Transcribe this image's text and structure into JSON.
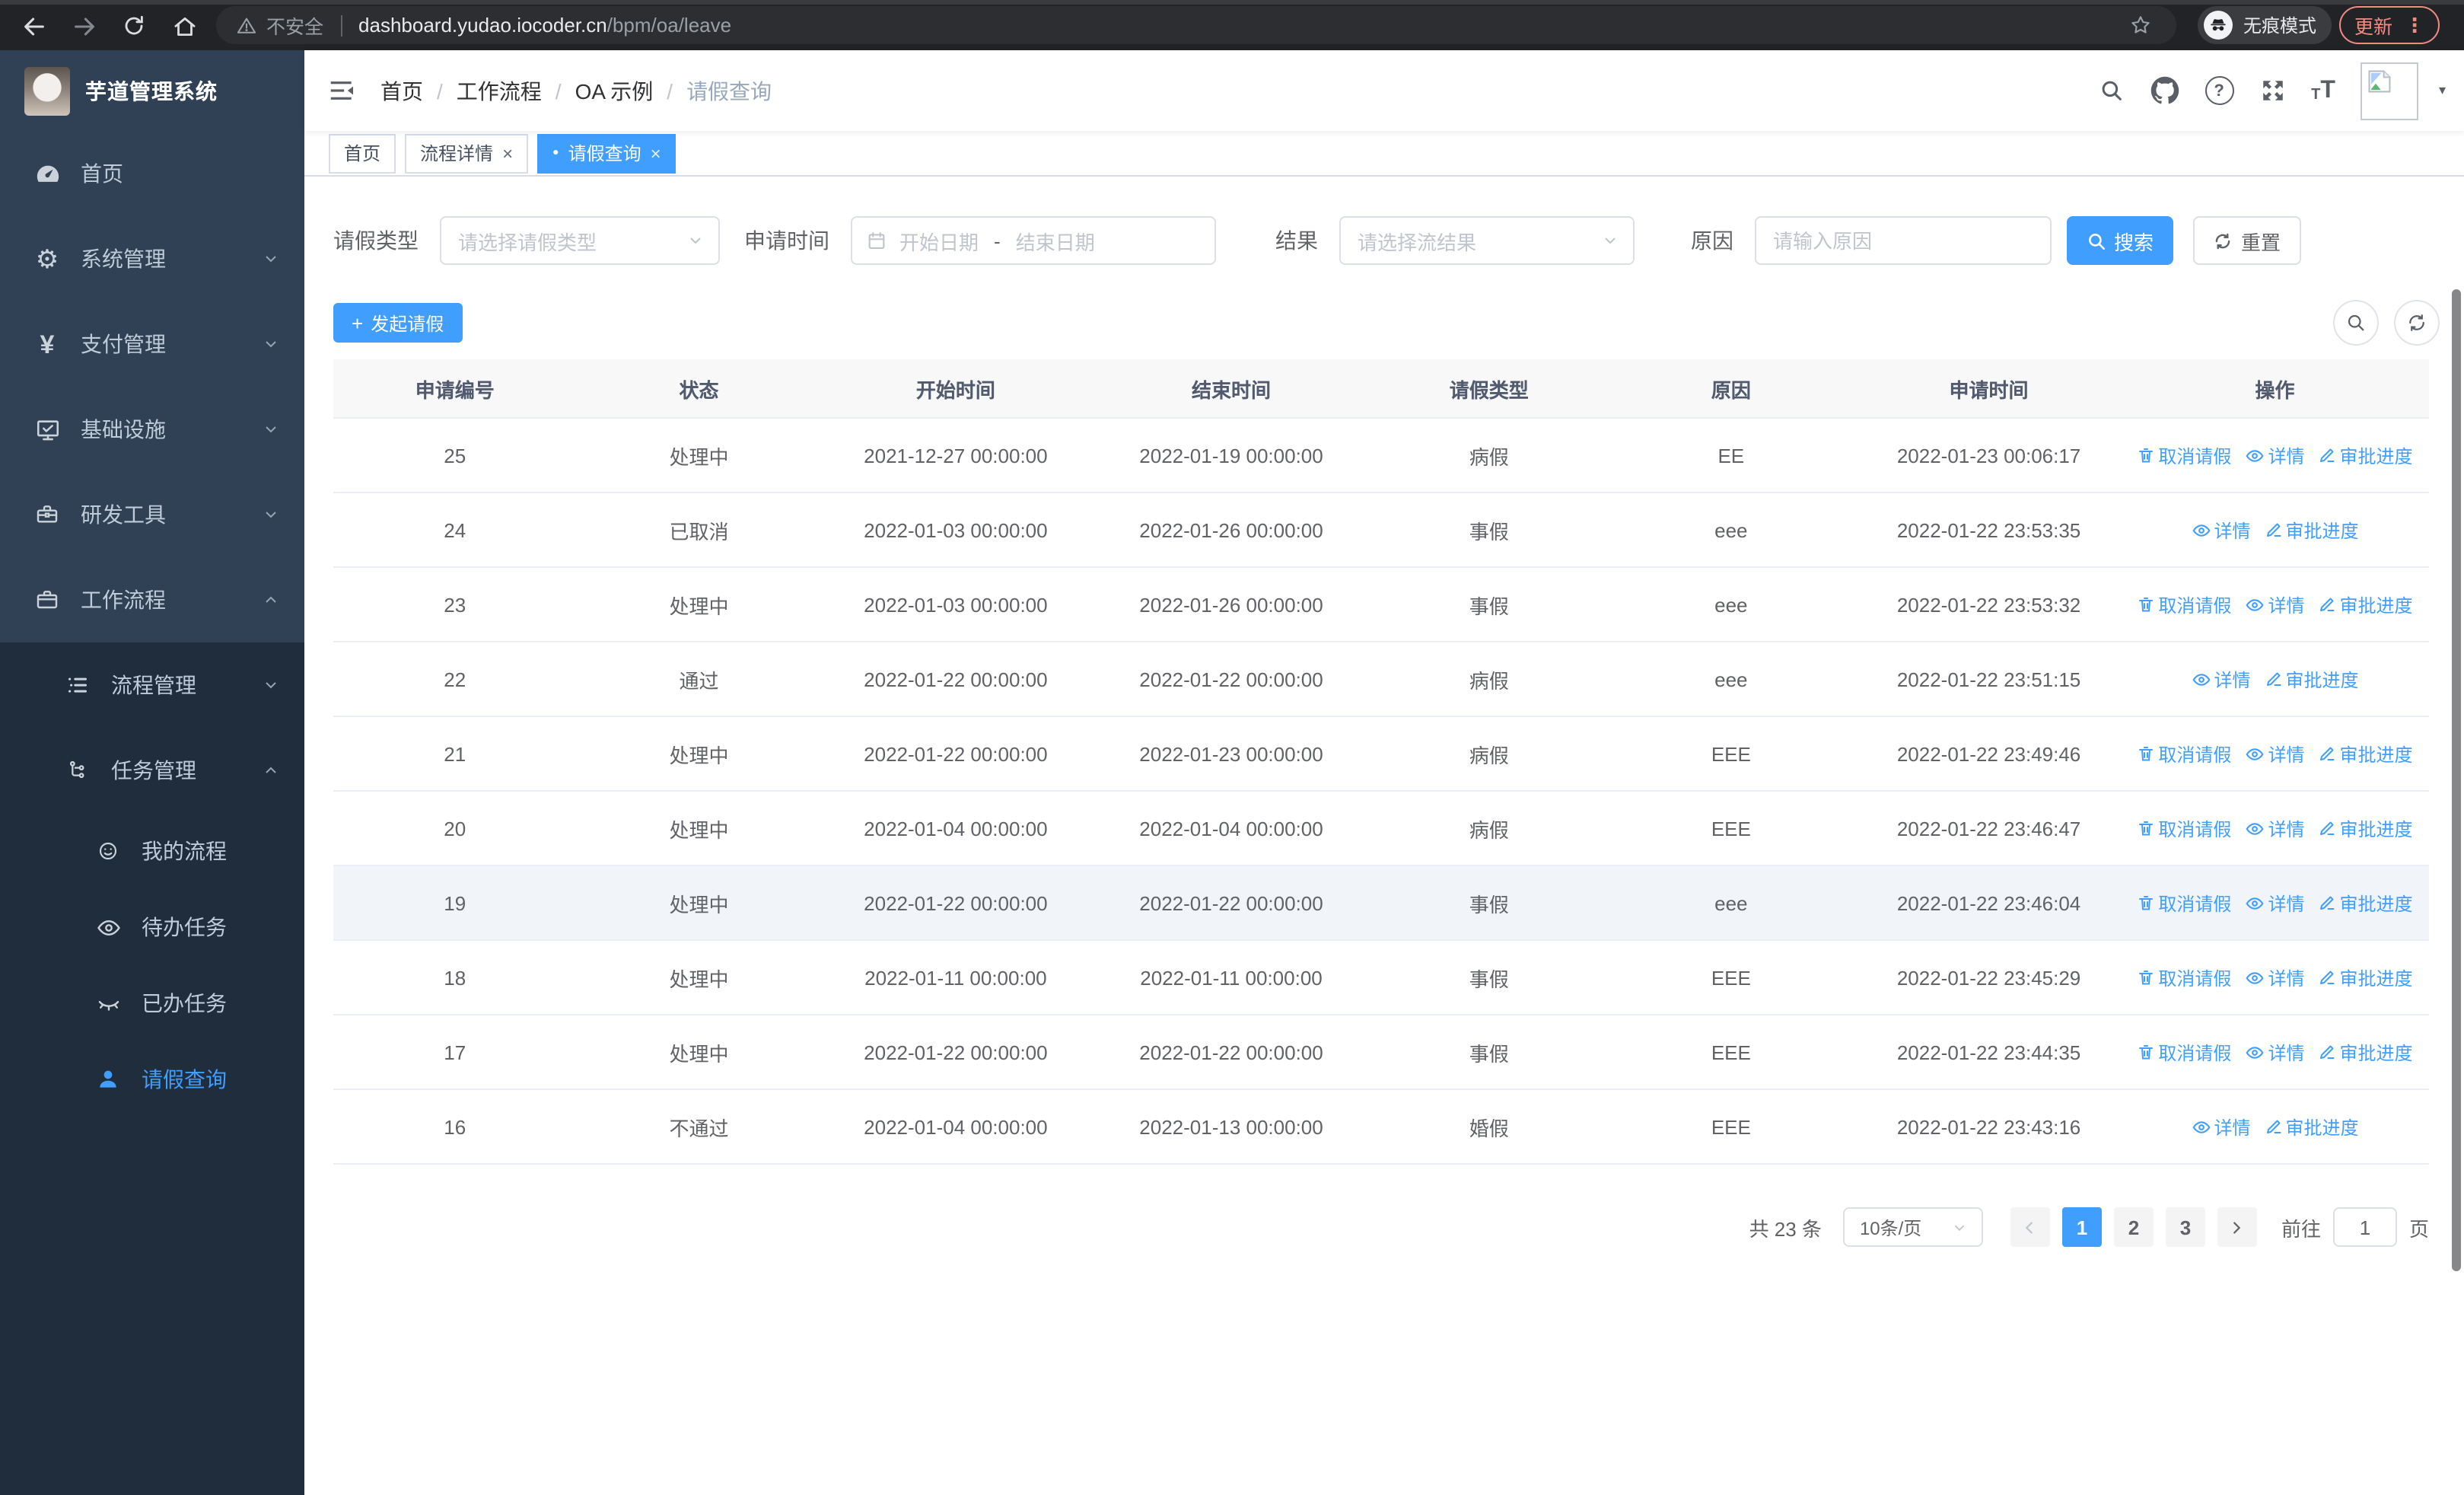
{
  "browser": {
    "security_label": "不安全",
    "url_host": "dashboard.yudao.iocoder.cn",
    "url_path": "/bpm/oa/leave",
    "incognito_label": "无痕模式",
    "update_label": "更新"
  },
  "icons": {
    "close": "×",
    "tab_dot": "●",
    "more_vertical": "⋮",
    "caret_down": "▾",
    "plus": "+",
    "yen": "¥",
    "gear": "⚙",
    "question": "?"
  },
  "sidebar": {
    "logo_title": "芋道管理系统",
    "menu": [
      {
        "label": "首页"
      },
      {
        "label": "系统管理"
      },
      {
        "label": "支付管理"
      },
      {
        "label": "基础设施"
      },
      {
        "label": "研发工具"
      },
      {
        "label": "工作流程"
      },
      {
        "label": "流程管理"
      },
      {
        "label": "任务管理"
      },
      {
        "label": "我的流程"
      },
      {
        "label": "待办任务"
      },
      {
        "label": "已办任务"
      },
      {
        "label": "请假查询"
      }
    ]
  },
  "header": {
    "breadcrumb": [
      "首页",
      "工作流程",
      "OA 示例",
      "请假查询"
    ],
    "separator": "/"
  },
  "tabs": [
    {
      "label": "首页",
      "closable": false,
      "active": false
    },
    {
      "label": "流程详情",
      "closable": true,
      "active": false
    },
    {
      "label": "请假查询",
      "closable": true,
      "active": true
    }
  ],
  "filters": {
    "leave_type_label": "请假类型",
    "leave_type_placeholder": "请选择请假类型",
    "apply_time_label": "申请时间",
    "start_placeholder": "开始日期",
    "range_separator": "-",
    "end_placeholder": "结束日期",
    "result_label": "结果",
    "result_placeholder": "请选择流结果",
    "reason_label": "原因",
    "reason_placeholder": "请输入原因",
    "search_label": "搜索",
    "reset_label": "重置"
  },
  "toolbar": {
    "create_label": "发起请假"
  },
  "table": {
    "headers": [
      "申请编号",
      "状态",
      "开始时间",
      "结束时间",
      "请假类型",
      "原因",
      "申请时间",
      "操作"
    ],
    "action_labels": {
      "cancel": "取消请假",
      "detail": "详情",
      "progress": "审批进度"
    },
    "rows": [
      {
        "id": "25",
        "status": "处理中",
        "start": "2021-12-27 00:00:00",
        "end": "2022-01-19 00:00:00",
        "type": "病假",
        "reason": "EE",
        "applied": "2022-01-23 00:06:17",
        "actions": [
          "cancel",
          "detail",
          "progress"
        ],
        "highlighted": false
      },
      {
        "id": "24",
        "status": "已取消",
        "start": "2022-01-03 00:00:00",
        "end": "2022-01-26 00:00:00",
        "type": "事假",
        "reason": "eee",
        "applied": "2022-01-22 23:53:35",
        "actions": [
          "detail",
          "progress"
        ],
        "highlighted": false
      },
      {
        "id": "23",
        "status": "处理中",
        "start": "2022-01-03 00:00:00",
        "end": "2022-01-26 00:00:00",
        "type": "事假",
        "reason": "eee",
        "applied": "2022-01-22 23:53:32",
        "actions": [
          "cancel",
          "detail",
          "progress"
        ],
        "highlighted": false
      },
      {
        "id": "22",
        "status": "通过",
        "start": "2022-01-22 00:00:00",
        "end": "2022-01-22 00:00:00",
        "type": "病假",
        "reason": "eee",
        "applied": "2022-01-22 23:51:15",
        "actions": [
          "detail",
          "progress"
        ],
        "highlighted": false
      },
      {
        "id": "21",
        "status": "处理中",
        "start": "2022-01-22 00:00:00",
        "end": "2022-01-23 00:00:00",
        "type": "病假",
        "reason": "EEE",
        "applied": "2022-01-22 23:49:46",
        "actions": [
          "cancel",
          "detail",
          "progress"
        ],
        "highlighted": false
      },
      {
        "id": "20",
        "status": "处理中",
        "start": "2022-01-04 00:00:00",
        "end": "2022-01-04 00:00:00",
        "type": "病假",
        "reason": "EEE",
        "applied": "2022-01-22 23:46:47",
        "actions": [
          "cancel",
          "detail",
          "progress"
        ],
        "highlighted": false
      },
      {
        "id": "19",
        "status": "处理中",
        "start": "2022-01-22 00:00:00",
        "end": "2022-01-22 00:00:00",
        "type": "事假",
        "reason": "eee",
        "applied": "2022-01-22 23:46:04",
        "actions": [
          "cancel",
          "detail",
          "progress"
        ],
        "highlighted": true
      },
      {
        "id": "18",
        "status": "处理中",
        "start": "2022-01-11 00:00:00",
        "end": "2022-01-11 00:00:00",
        "type": "事假",
        "reason": "EEE",
        "applied": "2022-01-22 23:45:29",
        "actions": [
          "cancel",
          "detail",
          "progress"
        ],
        "highlighted": false
      },
      {
        "id": "17",
        "status": "处理中",
        "start": "2022-01-22 00:00:00",
        "end": "2022-01-22 00:00:00",
        "type": "事假",
        "reason": "EEE",
        "applied": "2022-01-22 23:44:35",
        "actions": [
          "cancel",
          "detail",
          "progress"
        ],
        "highlighted": false
      },
      {
        "id": "16",
        "status": "不通过",
        "start": "2022-01-04 00:00:00",
        "end": "2022-01-13 00:00:00",
        "type": "婚假",
        "reason": "EEE",
        "applied": "2022-01-22 23:43:16",
        "actions": [
          "detail",
          "progress"
        ],
        "highlighted": false
      }
    ]
  },
  "pagination": {
    "total_text": "共 23 条",
    "page_size": "10条/页",
    "pages": [
      "1",
      "2",
      "3"
    ],
    "active_page": "1",
    "goto_label": "前往",
    "goto_value": "1",
    "page_unit": "页"
  },
  "colors": {
    "primary": "#409eff",
    "sidebar_bg": "#304156",
    "submenu_bg": "#1f2d3d",
    "update_accent": "#f28b82",
    "table_border": "#ebeef5"
  }
}
